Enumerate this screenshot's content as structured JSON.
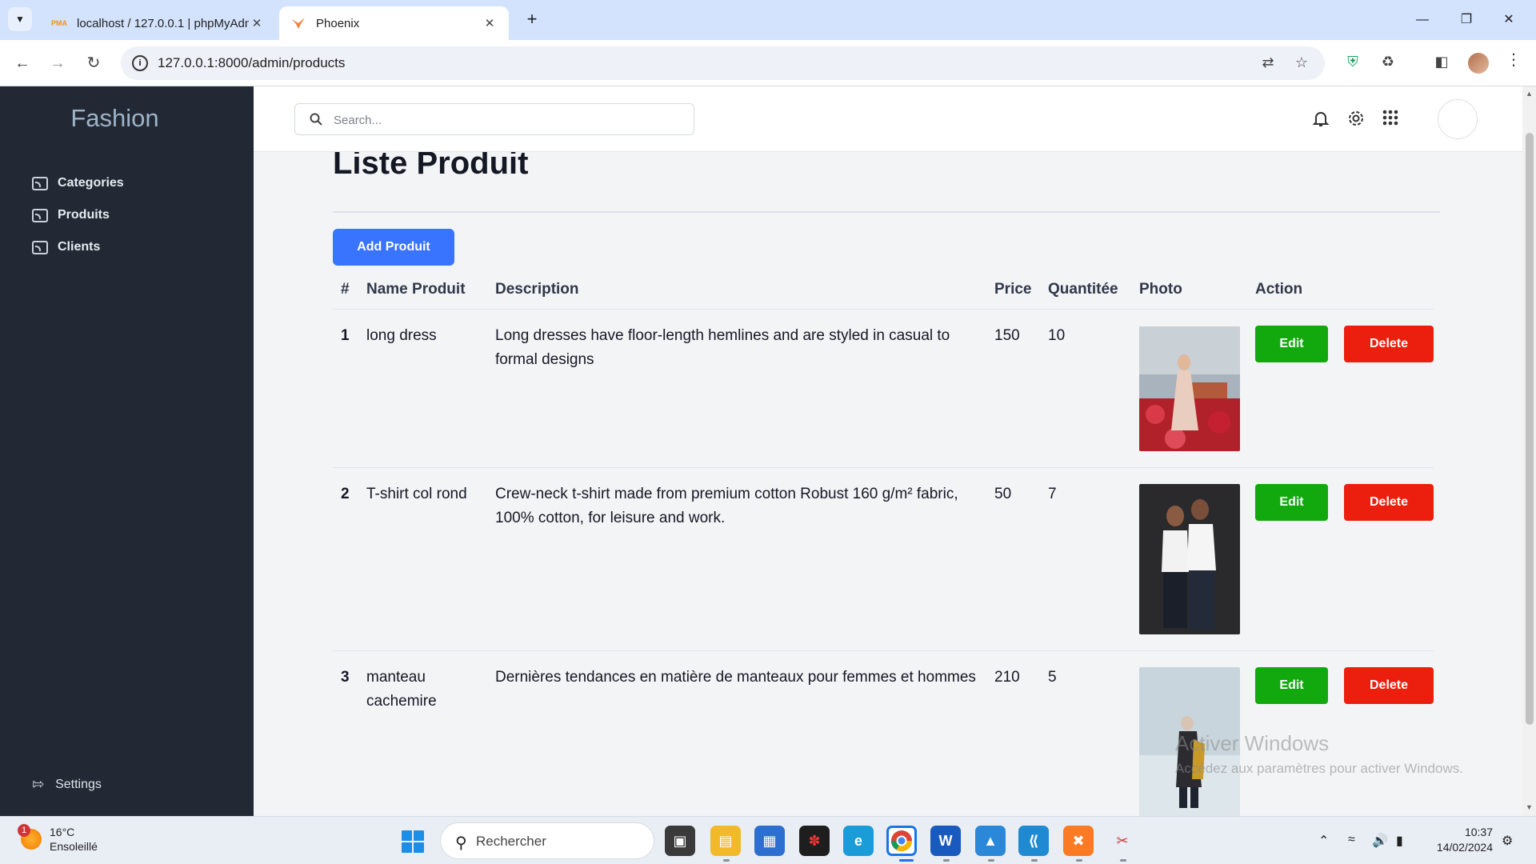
{
  "browser": {
    "tabs": [
      {
        "title": "localhost / 127.0.0.1 | phpMyAdmin",
        "favicon": "phpmyadmin-icon",
        "active": false
      },
      {
        "title": "Phoenix",
        "favicon": "phoenix-icon",
        "active": true
      }
    ],
    "url": "127.0.0.1:8000/admin/products"
  },
  "sidebar": {
    "brand": "Fashion",
    "items": [
      {
        "label": "Categories",
        "icon": "cast-icon"
      },
      {
        "label": "Produits",
        "icon": "cast-icon"
      },
      {
        "label": "Clients",
        "icon": "cast-icon"
      }
    ],
    "settings_label": "Settings"
  },
  "header": {
    "search_placeholder": "Search..."
  },
  "page": {
    "title": "Liste Produit",
    "add_button": "Add Produit"
  },
  "table": {
    "columns": [
      "#",
      "Name Produit",
      "Description",
      "Price",
      "Quantitée",
      "Photo",
      "Action"
    ],
    "rows": [
      {
        "num": "1",
        "name": "long dress",
        "description": "Long dresses have floor-length hemlines and are styled in casual to formal designs",
        "price": "150",
        "qty": "10",
        "edit": "Edit",
        "delete": "Delete"
      },
      {
        "num": "2",
        "name": "T-shirt col rond",
        "description": "Crew-neck t-shirt made from premium cotton Robust 160 g/m² fabric, 100% cotton, for leisure and work.",
        "price": "50",
        "qty": "7",
        "edit": "Edit",
        "delete": "Delete"
      },
      {
        "num": "3",
        "name": "manteau cachemire",
        "description": "Dernières tendances en matière de manteaux pour femmes et hommes",
        "price": "210",
        "qty": "5",
        "edit": "Edit",
        "delete": "Delete"
      }
    ]
  },
  "watermark": {
    "line1": "Activer Windows",
    "line2": "Accédez aux paramètres pour activer Windows."
  },
  "taskbar": {
    "weather_temp": "16°C",
    "weather_desc": "Ensoleillé",
    "weather_badge": "1",
    "search_label": "Rechercher",
    "time": "10:37",
    "date": "14/02/2024"
  },
  "colors": {
    "sidebar_bg": "#222934",
    "primary": "#3874ff",
    "edit": "#12a90e",
    "delete": "#ec1f0f"
  }
}
